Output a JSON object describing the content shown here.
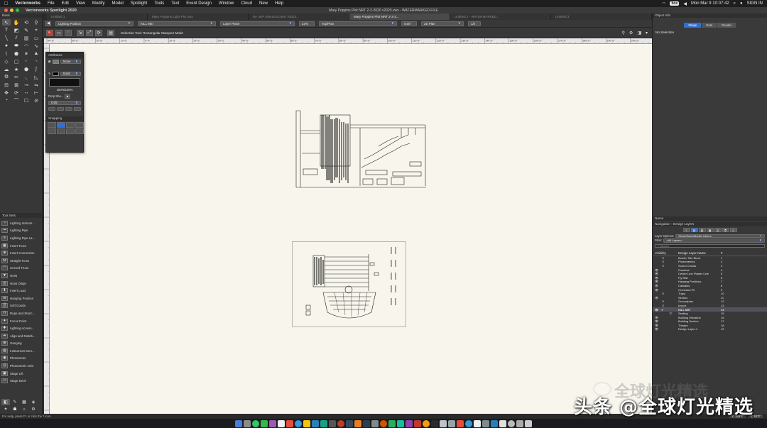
{
  "menubar": {
    "app_name": "Vectorworks",
    "items": [
      "File",
      "Edit",
      "View",
      "Modify",
      "Model",
      "Spotlight",
      "Tools",
      "Text",
      "Event Design",
      "Window",
      "Cloud",
      "New",
      "Help"
    ],
    "clock": "Mon Mar 9  10:07:42",
    "box_label": "box",
    "signin": "SIGN IN"
  },
  "window": {
    "app_title": "Vectorworks Spotlight 2020",
    "document_title": "Mary Poppins Plot NRT 2-2-2020 v2020.vwx - WATERMARKED FILE"
  },
  "tabs": [
    {
      "label": "Untitled 1",
      "active": false
    },
    {
      "label": "Mary Poppins Light Plot.vwx",
      "active": false
    },
    {
      "label": "IM- JKP Electrics DWG v2022...",
      "active": false
    },
    {
      "label": "Mary Poppins Plot NRT 2-2-2...",
      "active": true
    },
    {
      "label": "Untitled 2 - WATERMARKED...",
      "active": false
    },
    {
      "label": "Untitled 3",
      "active": false
    }
  ],
  "basic_palette": {
    "title": "Basic",
    "tools": [
      "pointer-icon",
      "pan-icon",
      "flyover-icon",
      "zoom-icon",
      "text-icon",
      "attribute-icon",
      "eyedropper-icon",
      "reshape-icon",
      "line-icon",
      "double-line-icon",
      "wall-icon",
      "rectangle-icon",
      "circle-icon",
      "oval-icon",
      "arc-icon",
      "freehand-icon",
      "polyline-icon",
      "polygon-icon",
      "spiral-icon",
      "triangle-icon",
      "rotated-rect-icon",
      "rounded-rect-icon",
      "quarter-arc-icon",
      "tangent-arc-icon",
      "cloud-icon",
      "star-icon",
      "hexagon-icon",
      "spline-icon",
      "offset-icon",
      "split-icon",
      "fillet-icon",
      "chamfer-icon",
      "clip-icon",
      "trim-icon",
      "connect-icon",
      "mirror-icon",
      "move-icon",
      "rotate-icon",
      "dimension-icon",
      "measure-icon",
      "protractor-icon",
      "tape-icon",
      "callout-icon",
      "section-icon"
    ]
  },
  "toolsets": {
    "title": "Tool Sets",
    "items": [
      "Lighting Instrum...",
      "Lighting Pipe",
      "Lighting Pipe La...",
      "Insert Truss",
      "Insert Connection",
      "Straight Truss",
      "Curved Truss",
      "Hoist",
      "Hoist Origin",
      "Insert Load",
      "Hanging Position",
      "Soft Goods",
      "Rope and Stanc...",
      "Focus Point",
      "Lighting Access...",
      "Align and Distrib...",
      "Ganging",
      "Instrument Sum...",
      "Photometer",
      "Photometric Grid",
      "Stage Lift",
      "Stage Deck"
    ]
  },
  "viewbar": {
    "class": "Lighting Position",
    "layer": "KILL ME!",
    "plane": "Layer Plane",
    "zoom": "23%",
    "view": "Top/Plan",
    "angle": "0.00°",
    "render": "2D Plan",
    "layer_count": "1/2"
  },
  "modebar": {
    "mode_label": "Selection Tool: Rectangular Marquee Mode"
  },
  "ruler_labels": [
    "40'-0\"",
    "30'-0\"",
    "20'-0\"",
    "10'-0\"",
    "0'-0\"",
    "10'-0\"",
    "20'-0\"",
    "30'-0\"",
    "40'-0\"",
    "50'-0\"",
    "60'-0\"",
    "70'-0\"",
    "80'-0\"",
    "90'-0\"",
    "100'-0\"",
    "110'-0\"",
    "120'-0\"",
    "130'-0\"",
    "140'-0\"",
    "150'-0\"",
    "160'-0\"",
    "170'-0\"",
    "180'-0\"",
    "190'-0\"",
    "200'-0\""
  ],
  "attributes": {
    "title": "Attributes",
    "fill": "None",
    "pen": "Solid",
    "opacity": "100%/100%",
    "drop_shadow": "Drop Sha...",
    "thickness": "0.05",
    "snapping_title": "Snapping"
  },
  "object_info": {
    "title": "Object Info",
    "tabs": [
      "Shape",
      "Data",
      "Render"
    ],
    "active_tab": "Shape",
    "selection": "No Selection"
  },
  "navigation": {
    "name_label": "Name",
    "title": "Navigation - Design Layers",
    "layer_options_label": "Layer Options:",
    "layer_options_value": "Show/Snap/Modify Others",
    "filter_label": "Filter:",
    "filter_value": "<All Layers>",
    "search_placeholder": "Search",
    "col_visibility": "Visibility",
    "col_name": "Design Layer Name",
    "col_num": "#",
    "layers": [
      {
        "vis": "x",
        "name": "Border Title Block",
        "num": "1"
      },
      {
        "vis": "x",
        "name": "Photometrics",
        "num": "2"
      },
      {
        "vis": "x",
        "name": "Sound Clouds",
        "num": "3"
      },
      {
        "vis": "eye",
        "name": "Practical",
        "num": "4"
      },
      {
        "vis": "eye",
        "name": "Center Line Plaster Line",
        "num": "5"
      },
      {
        "vis": "eye",
        "name": "Fly Rail",
        "num": "6"
      },
      {
        "vis": "eye",
        "name": "Hanging Positions",
        "num": "7"
      },
      {
        "vis": "eye",
        "name": "Catwalks",
        "num": "8"
      },
      {
        "vis": "eye",
        "name": "Orchestra Pit",
        "num": "9"
      },
      {
        "vis": "x",
        "name": "Traps",
        "num": "10"
      },
      {
        "vis": "eye",
        "name": "Section",
        "num": "11"
      },
      {
        "vis": "x",
        "name": "Groundplan",
        "num": "12"
      },
      {
        "vis": "x",
        "name": "Import",
        "num": "13"
      },
      {
        "vis": "eye",
        "name": "KILL ME!",
        "num": "14",
        "active": true
      },
      {
        "vis": "dim",
        "name": "Seating",
        "num": "15"
      },
      {
        "vis": "eye",
        "name": "Building Elevation",
        "num": "16"
      },
      {
        "vis": "eye",
        "name": "Building Section",
        "num": "17"
      },
      {
        "vis": "eye",
        "name": "Theatre",
        "num": "18"
      },
      {
        "vis": "eye",
        "name": "Design Layer-1",
        "num": "19"
      }
    ]
  },
  "statusbar": {
    "hint": "For Help, press F1 or click the ? icon",
    "x_value": "X: 169'0\"",
    "y_value": "Y: 51'0\""
  },
  "dock_colors": [
    "#4a7bd6",
    "#8c8c8c",
    "#2ec866",
    "#3ab54a",
    "#9b59b6",
    "#eeeeee",
    "#e74c3c",
    "#3498db",
    "#f1c40f",
    "#2980b9",
    "#16a085",
    "#555555",
    "#c0392b",
    "#34495e",
    "#e67e22",
    "#2c3e50",
    "#7f8c8d",
    "#d35400",
    "#27ae60",
    "#1abc9c",
    "#8e44ad",
    "#c0392b",
    "#f39c12",
    "#2c2c2c",
    "#bdc3c7",
    "#95a5a6",
    "#e74c3c",
    "#3498db",
    "#ecf0f1",
    "#7f8c8d",
    "#2980b9",
    "#e0e0e0",
    "#bbbbbb",
    "#aaaaaa",
    "#cccccc"
  ],
  "watermark": {
    "text": "头条 @全球灯光精选",
    "ghost_text": "全球灯光精选"
  }
}
